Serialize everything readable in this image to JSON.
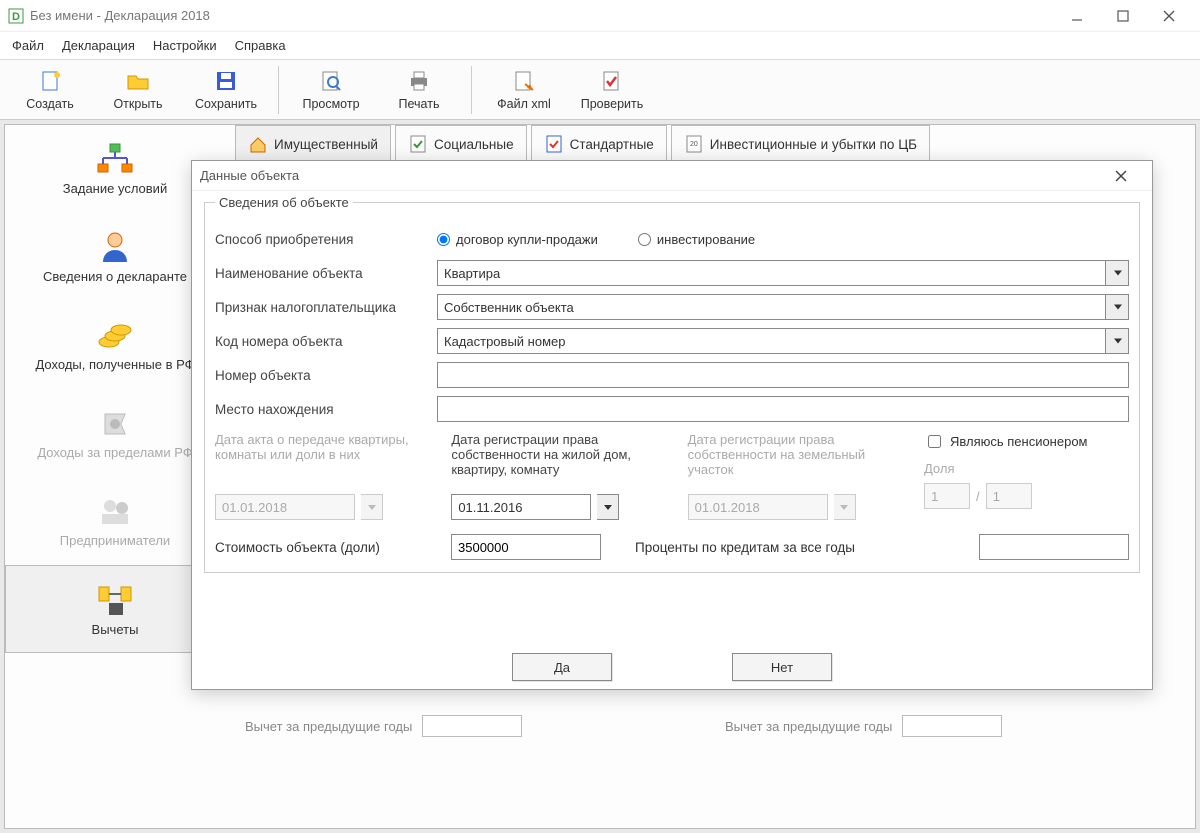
{
  "window": {
    "title": "Без имени - Декларация 2018"
  },
  "menu": {
    "file": "Файл",
    "declaration": "Декларация",
    "settings": "Настройки",
    "help": "Справка"
  },
  "toolbar": {
    "create": "Создать",
    "open": "Открыть",
    "save": "Сохранить",
    "preview": "Просмотр",
    "print": "Печать",
    "filexml": "Файл xml",
    "check": "Проверить"
  },
  "sidenav": {
    "conditions": "Задание условий",
    "declarant": "Сведения о декларанте",
    "income_rf": "Доходы, полученные в РФ",
    "income_abroad": "Доходы за пределами РФ",
    "entrepreneur": "Предприниматели",
    "deductions": "Вычеты"
  },
  "tabs": {
    "property": "Имущественный",
    "social": "Социальные",
    "standard": "Стандартные",
    "investment": "Инвестиционные и убытки по ЦБ"
  },
  "lower": {
    "prev_years": "Вычет за предыдущие годы"
  },
  "dialog": {
    "title": "Данные объекта",
    "fieldset": "Сведения об объекте",
    "labels": {
      "acq_method": "Способ приобретения",
      "radio_purchase": "договор купли-продажи",
      "radio_invest": "инвестирование",
      "obj_name": "Наименование объекта",
      "taxpayer_sign": "Признак налогоплательщика",
      "obj_code": "Код номера объекта",
      "obj_number": "Номер объекта",
      "location": "Место нахождения",
      "date_act": "Дата акта о передаче квартиры, комнаты или доли в них",
      "date_reg_prop": "Дата регистрации права собственности на жилой дом, квартиру, комнату",
      "date_reg_land": "Дата регистрации права собственности на земельный участок",
      "pensioner": "Являюсь пенсионером",
      "share": "Доля",
      "cost": "Стоимость объекта (доли)",
      "interest": "Проценты по кредитам за все годы"
    },
    "values": {
      "obj_name": "Квартира",
      "taxpayer_sign": "Собственник объекта",
      "obj_code": "Кадастровый номер",
      "obj_number": "",
      "location": "",
      "date_act": "01.01.2018",
      "date_reg_prop": "01.11.2016",
      "date_reg_land": "01.01.2018",
      "share_num": "1",
      "share_den": "1",
      "cost": "3500000",
      "interest": ""
    },
    "buttons": {
      "yes": "Да",
      "no": "Нет"
    }
  }
}
